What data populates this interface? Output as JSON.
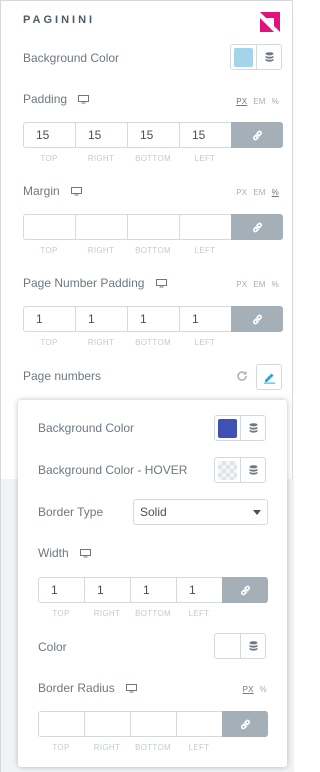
{
  "panel": {
    "title": "PAGININI"
  },
  "bg_color": {
    "label": "Background Color",
    "value": "#a3d4ea"
  },
  "padding": {
    "label": "Padding",
    "units": [
      "PX",
      "EM",
      "%"
    ],
    "active_unit": "PX",
    "values": [
      "15",
      "15",
      "15",
      "15"
    ],
    "sides": [
      "TOP",
      "RIGHT",
      "BOTTOM",
      "LEFT"
    ]
  },
  "margin": {
    "label": "Margin",
    "units": [
      "PX",
      "EM",
      "%"
    ],
    "active_unit": "%",
    "values": [
      "",
      "",
      "",
      ""
    ],
    "sides": [
      "TOP",
      "RIGHT",
      "BOTTOM",
      "LEFT"
    ]
  },
  "page_number_padding": {
    "label": "Page Number Padding",
    "units": [
      "PX",
      "EM",
      "%"
    ],
    "active_unit": "PX",
    "values": [
      "1",
      "1",
      "1",
      "1"
    ],
    "sides": [
      "TOP",
      "RIGHT",
      "BOTTOM",
      "LEFT"
    ]
  },
  "page_numbers": {
    "label": "Page numbers"
  },
  "popup": {
    "bg_color": {
      "label": "Background Color",
      "value": "#3f51b5"
    },
    "bg_hover": {
      "label": "Background Color - HOVER"
    },
    "border_type": {
      "label": "Border Type",
      "value": "Solid"
    },
    "width": {
      "label": "Width",
      "values": [
        "1",
        "1",
        "1",
        "1"
      ],
      "sides": [
        "TOP",
        "RIGHT",
        "BOTTOM",
        "LEFT"
      ]
    },
    "color": {
      "label": "Color"
    },
    "border_radius": {
      "label": "Border Radius",
      "units": [
        "PX",
        "%"
      ],
      "active_unit": "PX",
      "values": [
        "",
        "",
        "",
        ""
      ],
      "sides": [
        "TOP",
        "RIGHT",
        "BOTTOM",
        "LEFT"
      ]
    }
  }
}
